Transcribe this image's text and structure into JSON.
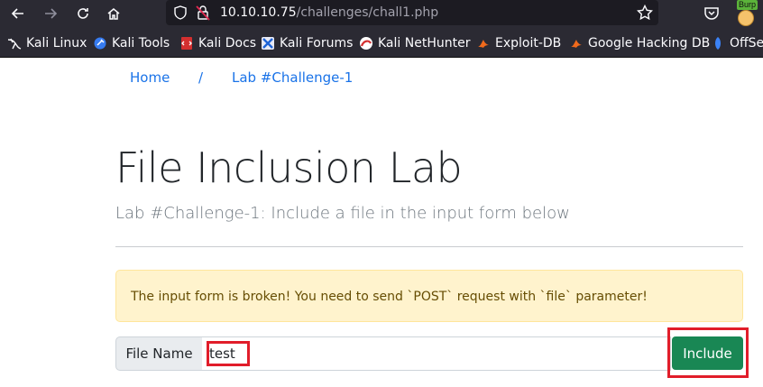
{
  "browser": {
    "url_host": "10.10.10.75",
    "url_path": "/challenges/chall1.php",
    "extension_label": "Burp",
    "bookmarks": [
      "Kali Linux",
      "Kali Tools",
      "Kali Docs",
      "Kali Forums",
      "Kali NetHunter",
      "Exploit-DB",
      "Google Hacking DB",
      "OffSe"
    ]
  },
  "breadcrumb": {
    "home": "Home",
    "separator": "/",
    "current": "Lab #Challenge-1"
  },
  "page": {
    "title": "File Inclusion Lab",
    "subtitle": "Lab #Challenge-1: Include a file in the input form below",
    "alert": "The input form is broken! You need to send `POST` request with `file` parameter!"
  },
  "form": {
    "label": "File Name",
    "value": "test",
    "button": "Include"
  },
  "colors": {
    "link": "#1a73e8",
    "button": "#198754",
    "alert_bg": "#fff3cd",
    "highlight": "#e11d2a"
  }
}
